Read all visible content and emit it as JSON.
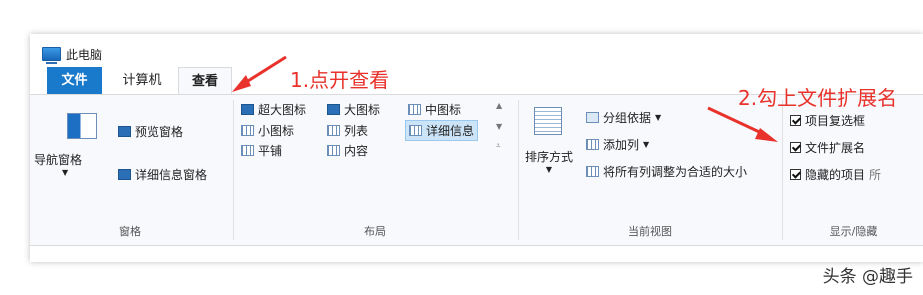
{
  "window": {
    "title": "此电脑"
  },
  "tabs": [
    {
      "label": "文件"
    },
    {
      "label": "计算机"
    },
    {
      "label": "查看"
    }
  ],
  "panes_group": {
    "nav_pane": "导航窗格",
    "preview_pane": "预览窗格",
    "details_pane": "详细信息窗格",
    "label": "窗格"
  },
  "layout_group": {
    "items": [
      "超大图标",
      "大图标",
      "中图标",
      "小图标",
      "列表",
      "详细信息",
      "平铺",
      "内容"
    ],
    "selected": "详细信息",
    "label": "布局"
  },
  "current_view_group": {
    "sort_by": "排序方式",
    "group_by": "分组依据",
    "add_columns": "添加列",
    "size_all_columns": "将所有列调整为合适的大小",
    "label": "当前视图"
  },
  "show_hide_group": {
    "item_checkboxes": "项目复选框",
    "file_extensions": "文件扩展名",
    "hidden_items": "隐藏的项目",
    "hidden_items_trailing": "所",
    "label": "显示/隐藏"
  },
  "annotations": {
    "step1": "1.点开查看",
    "step2": "2.勾上文件扩展名",
    "color": "#e8322b"
  },
  "watermark": "头条 @趣手"
}
